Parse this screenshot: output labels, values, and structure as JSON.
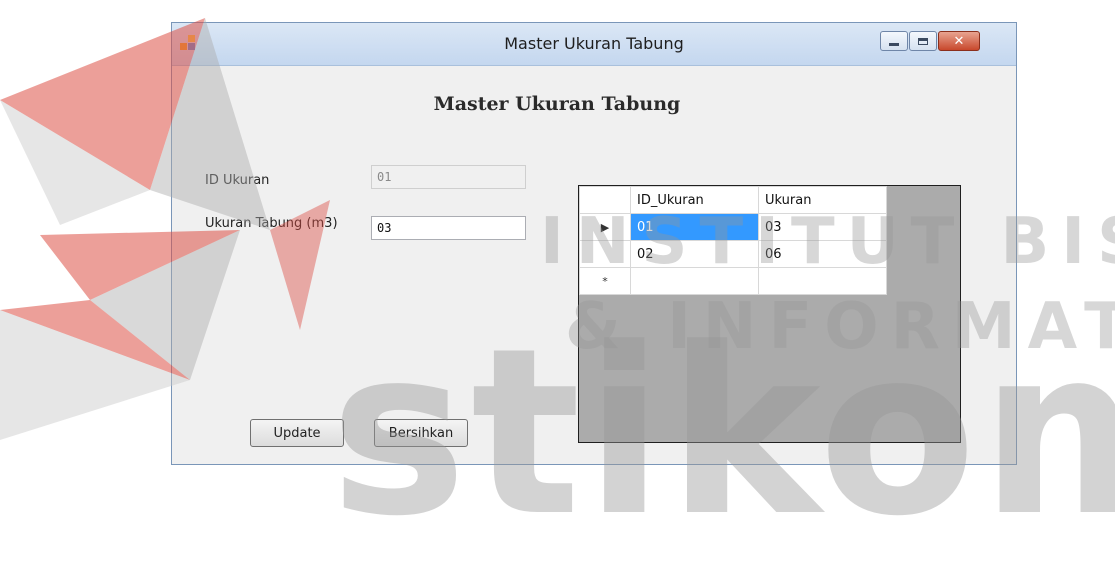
{
  "window": {
    "title": "Master Ukuran Tabung",
    "minimize_icon": "minimize-icon",
    "maximize_icon": "maximize-icon",
    "close_icon": "close-icon"
  },
  "form": {
    "heading": "Master Ukuran Tabung",
    "id_label": "ID Ukuran",
    "id_value": "01",
    "size_label": "Ukuran Tabung (m3)",
    "size_value": "03",
    "update_label": "Update",
    "clear_label": "Bersihkan"
  },
  "grid": {
    "columns": [
      "ID_Ukuran",
      "Ukuran"
    ],
    "rows": [
      {
        "marker": "▶",
        "id": "01",
        "size": "03"
      },
      {
        "marker": "",
        "id": "02",
        "size": "06"
      },
      {
        "marker": "*",
        "id": "",
        "size": ""
      }
    ],
    "selection_color": "#3399ff"
  },
  "watermark": {
    "line1": "INSTITUT BISNIS",
    "line2": "& INFORMATIKA",
    "brand": "stikom"
  }
}
